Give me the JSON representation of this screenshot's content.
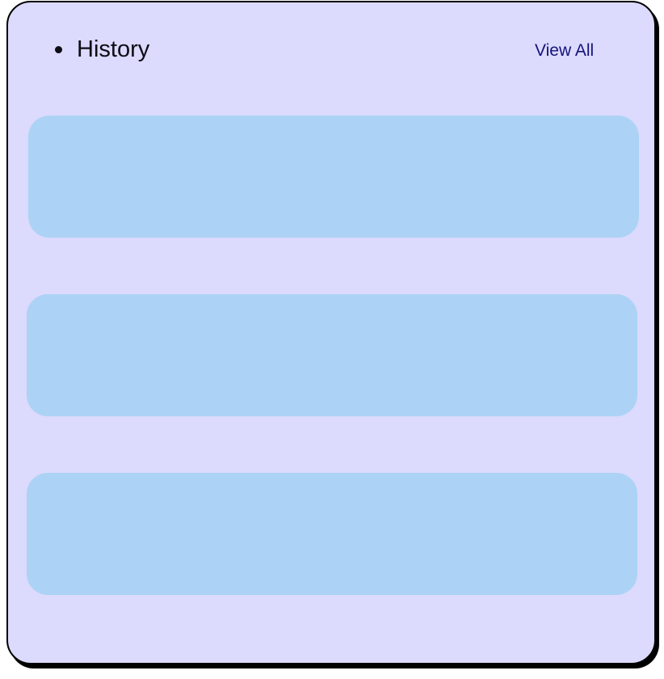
{
  "header": {
    "title": "History",
    "view_all_label": "View All"
  },
  "history": {
    "items": [
      {
        "label": ""
      },
      {
        "label": ""
      },
      {
        "label": ""
      }
    ]
  },
  "colors": {
    "card_background": "#dcdafd",
    "item_background": "#acd3f5",
    "link_color": "#14147a"
  }
}
